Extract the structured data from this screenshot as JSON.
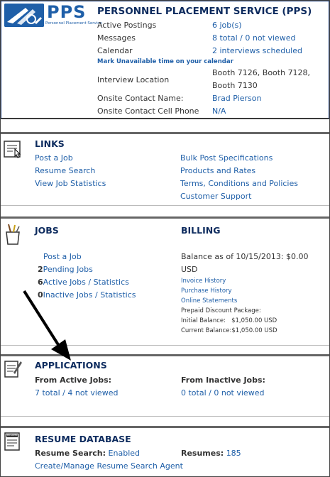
{
  "header": {
    "logo_text": "PPS",
    "logo_sub": "Personnel Placement Service",
    "title": "PERSONNEL PLACEMENT SERVICE (PPS)",
    "rows": {
      "active_postings_label": "Active Postings",
      "active_postings_value": "6 job(s)",
      "messages_label": "Messages",
      "messages_total": "8 total",
      "messages_sep": "/",
      "messages_unviewed": "0 not viewed",
      "calendar_label": "Calendar",
      "calendar_value": "2 interviews scheduled",
      "mark_unavailable": "Mark Unavailable time on your calendar",
      "interview_location_label": "Interview Location",
      "interview_location_line1": "Booth 7126, Booth 7128,",
      "interview_location_line2": "Booth 7130",
      "onsite_contact_name_label": "Onsite Contact Name:",
      "onsite_contact_name_value": "Brad Pierson",
      "onsite_contact_phone_label": "Onsite Contact Cell Phone",
      "onsite_contact_phone_value": "N/A"
    }
  },
  "links": {
    "title": "LINKS",
    "left": [
      "Post a Job",
      "Resume Search",
      "View Job Statistics"
    ],
    "right": [
      "Bulk Post Specifications",
      "Products and Rates",
      "Terms, Conditions and Policies",
      "Customer Support"
    ]
  },
  "jobs": {
    "title": "JOBS",
    "post_job": "Post a Job",
    "pending_count": "2",
    "pending_label": "Pending Jobs",
    "active_count": "6",
    "active_label": "Active Jobs",
    "inactive_count": "0",
    "inactive_label": "Inactive Jobs",
    "sep": "/",
    "statistics": "Statistics"
  },
  "billing": {
    "title": "BILLING",
    "balance_line1": "Balance as of 10/15/2013: $0.00",
    "balance_line2": "USD",
    "invoice_history": "Invoice History",
    "purchase_history": "Purchase History",
    "online_statements": "Online Statements",
    "prepaid_label": "Prepaid Discount Package:",
    "initial_balance": "Initial Balance:   $1,050.00 USD",
    "current_balance": "Current Balance:$1,050.00 USD"
  },
  "applications": {
    "title": "APPLICATIONS",
    "from_active_label": "From Active Jobs:",
    "active_total": "7 total",
    "active_unviewed": "4 not viewed",
    "from_inactive_label": "From Inactive Jobs:",
    "inactive_total": "0 total",
    "inactive_unviewed": "0 not viewed",
    "sep": "/"
  },
  "resume_db": {
    "title": "RESUME DATABASE",
    "resume_search_label": "Resume Search:",
    "resume_search_value": "Enabled",
    "resumes_label": "Resumes:",
    "resumes_value": "185",
    "create_agent": "Create/Manage Resume Search Agent",
    "icon_text": "RESUME"
  },
  "colors": {
    "link": "#1f5fa8",
    "title": "#0d2b5e",
    "arrow": "#000000"
  }
}
